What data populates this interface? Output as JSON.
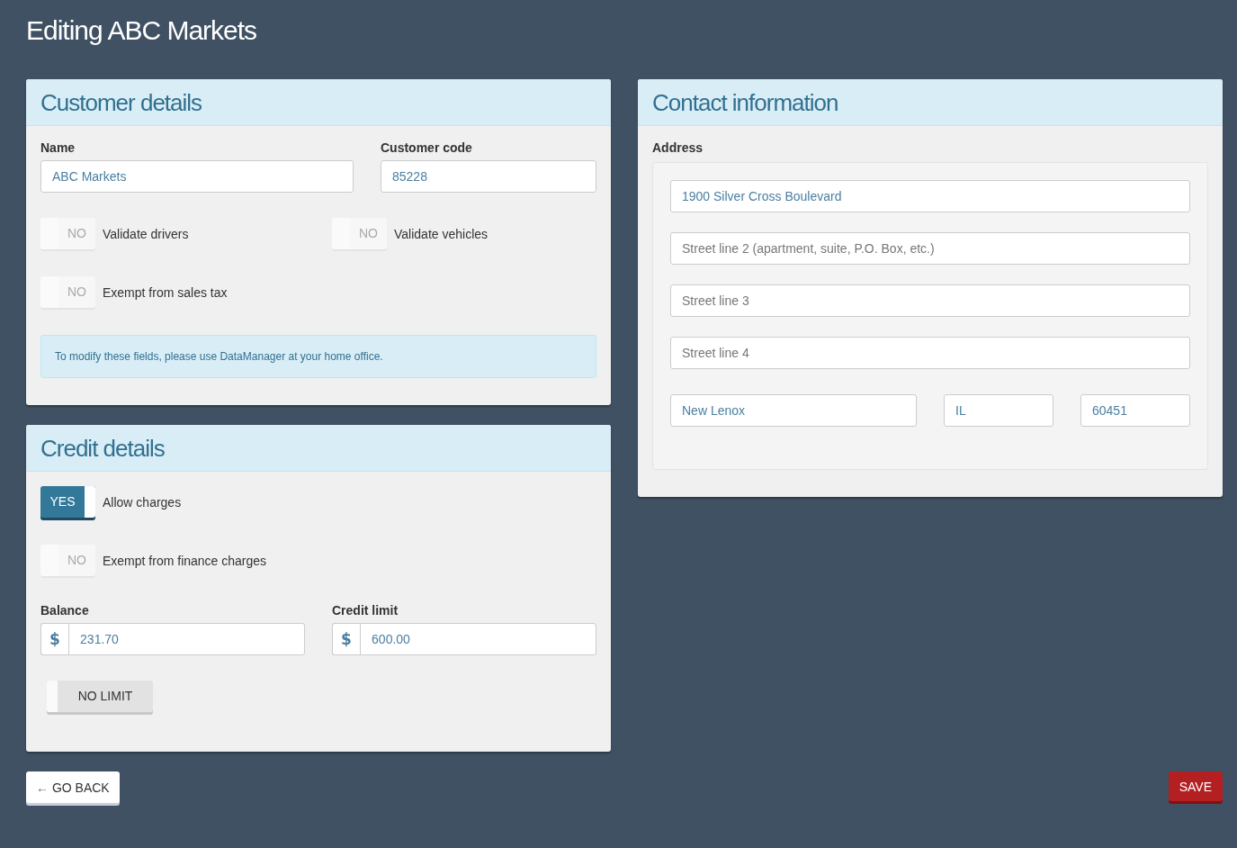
{
  "page_title": "Editing ABC Markets",
  "customer_details": {
    "title": "Customer details",
    "fields": [
      {
        "label": "Name",
        "value": "ABC Markets"
      },
      {
        "label": "Customer code",
        "value": "85228"
      }
    ],
    "toggles": [
      {
        "state_label": "NO",
        "label": "Validate drivers",
        "on": false
      },
      {
        "state_label": "NO",
        "label": "Validate vehicles",
        "on": false
      },
      {
        "state_label": "NO",
        "label": "Exempt from sales tax",
        "on": false
      }
    ],
    "notice": "To modify these fields, please use DataManager at your home office."
  },
  "credit_details": {
    "title": "Credit details",
    "toggles": [
      {
        "state_label": "YES",
        "label": "Allow charges",
        "on": true
      },
      {
        "state_label": "NO",
        "label": "Exempt from finance charges",
        "on": false
      }
    ],
    "money_fields": [
      {
        "label": "Balance",
        "currency": "$",
        "value": "231.70"
      },
      {
        "label": "Credit limit",
        "currency": "$",
        "value": "600.00"
      }
    ],
    "no_limit": {
      "label": "NO LIMIT",
      "on": false
    }
  },
  "contact_information": {
    "title": "Contact information",
    "address_label": "Address",
    "street_lines": [
      {
        "value": "1900 Silver Cross Boulevard"
      },
      {
        "placeholder": "Street line 2 (apartment, suite, P.O. Box, etc.)"
      },
      {
        "placeholder": "Street line 3"
      },
      {
        "placeholder": "Street line 4"
      }
    ],
    "city": {
      "value": "New Lenox"
    },
    "state": {
      "value": "IL"
    },
    "zip": {
      "value": "60451"
    }
  },
  "actions": {
    "back_arrow": "←",
    "back": "GO BACK",
    "save": "SAVE"
  }
}
